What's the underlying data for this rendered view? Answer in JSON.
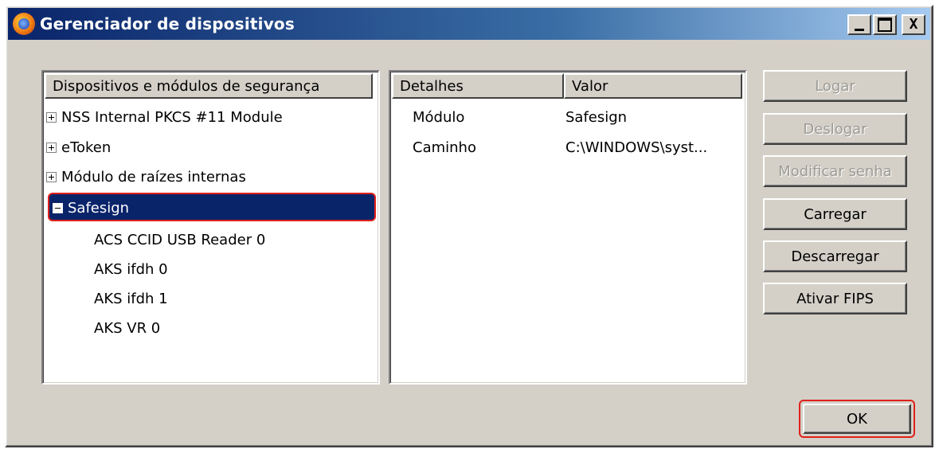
{
  "window": {
    "title": "Gerenciador de dispositivos",
    "caption_buttons": [
      "minimize",
      "maximize",
      "close"
    ],
    "close_label": "X"
  },
  "tree": {
    "header": "Dispositivos e módulos de segurança",
    "items": [
      {
        "label": "NSS Internal PKCS #11 Module",
        "expander": "plus"
      },
      {
        "label": "eToken",
        "expander": "plus"
      },
      {
        "label": "Módulo de raízes internas",
        "expander": "plus"
      },
      {
        "label": "Safesign",
        "expander": "minus",
        "selected": true
      }
    ],
    "children": [
      "ACS CCID USB Reader 0",
      "AKS ifdh 0",
      "AKS ifdh 1",
      "AKS VR 0"
    ]
  },
  "details": {
    "headers": [
      "Detalhes",
      "Valor"
    ],
    "rows": [
      {
        "key": "Módulo",
        "value": "Safesign"
      },
      {
        "key": "Caminho",
        "value": "C:\\WINDOWS\\syst..."
      }
    ]
  },
  "buttons": {
    "login": "Logar",
    "logout": "Deslogar",
    "change_password": "Modificar senha",
    "load": "Carregar",
    "unload": "Descarregar",
    "enable_fips": "Ativar FIPS",
    "ok": "OK"
  },
  "colors": {
    "selection": "#0a246a",
    "highlight_outline": "#e0201a",
    "dialog_face": "#d4d0c8"
  }
}
